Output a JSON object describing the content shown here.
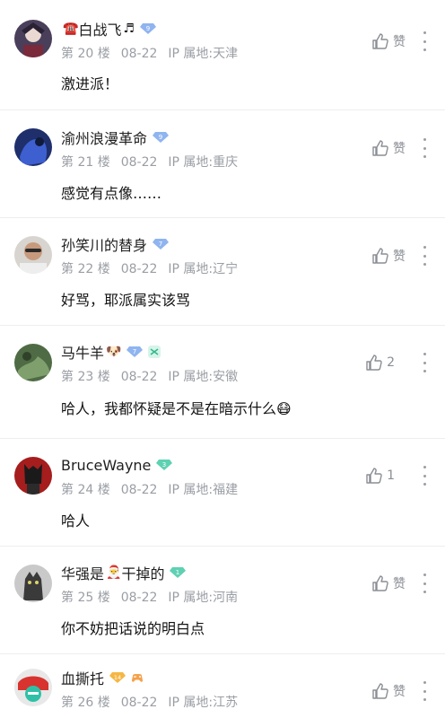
{
  "comments": [
    {
      "name": "白战飞",
      "prefix": "☎️",
      "suffix": "♬",
      "level": "9",
      "level_color": "#8fb4f0",
      "floor": "第 20 楼",
      "date": "08-22",
      "ip": "IP 属地:天津",
      "content": "激进派！",
      "like": "赞"
    },
    {
      "name": "渝州浪漫革命",
      "level": "9",
      "level_color": "#8fb4f0",
      "floor": "第 21 楼",
      "date": "08-22",
      "ip": "IP 属地:重庆",
      "content": "感觉有点像……",
      "like": "赞"
    },
    {
      "name": "孙笑川的替身",
      "level": "7",
      "level_color": "#8fb4f0",
      "floor": "第 22 楼",
      "date": "08-22",
      "ip": "IP 属地:辽宁",
      "content": "好骂，耶派属实该骂",
      "like": "赞"
    },
    {
      "name": "马牛羊",
      "suffix": "🐶",
      "level": "7",
      "level_color": "#8fb4f0",
      "floor": "第 23 楼",
      "date": "08-22",
      "ip": "IP 属地:安徽",
      "content": "哈人，我都怀疑是不是在暗示什么",
      "content_emoji": "😷",
      "like": "2"
    },
    {
      "name": "BruceWayne",
      "level": "3",
      "level_color": "#5fd1b3",
      "floor": "第 24 楼",
      "date": "08-22",
      "ip": "IP 属地:福建",
      "content": "哈人",
      "like": "1"
    },
    {
      "name_a": "华强是",
      "name_emoji": "🎅",
      "name_b": "干掉的",
      "level": "1",
      "level_color": "#5fd1b3",
      "floor": "第 25 楼",
      "date": "08-22",
      "ip": "IP 属地:河南",
      "content": "你不妨把话说的明白点",
      "like": "赞"
    },
    {
      "name": "血撕托",
      "level": "14",
      "level_color": "#f5b743",
      "floor": "第 26 楼",
      "date": "08-22",
      "ip": "IP 属地:江苏",
      "like": "赞"
    }
  ]
}
